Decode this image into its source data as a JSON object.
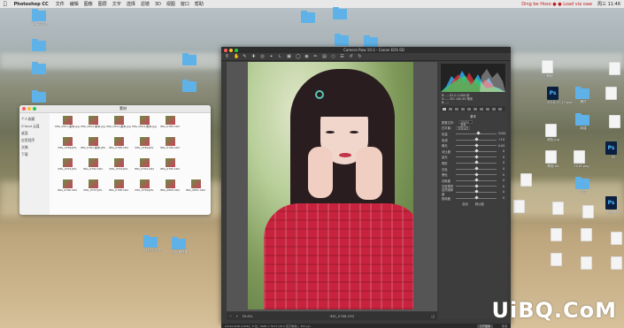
{
  "menubar": {
    "app_name": "Photoshop CC",
    "items": [
      "文件",
      "编辑",
      "图像",
      "图层",
      "文字",
      "选择",
      "滤镜",
      "3D",
      "视图",
      "窗口",
      "帮助"
    ],
    "alert_text": "Ding be Hoso ● ● Load via oaw",
    "clock": "周三 11:46"
  },
  "finder": {
    "title": "素材",
    "sidebar": [
      "个人收藏",
      "iCloud 云盘",
      "桌面",
      "应用程序",
      "文稿",
      "下载"
    ],
    "files": [
      "IMG_0501-副本.jpg",
      "IMG_0502-副本.jpg",
      "IMG_0503-副本.jpg",
      "IMG_0504-副本.jpg",
      "IMG_0785.CR2",
      "",
      "IMG_0786.JPG",
      "IMG_0787-副本.JPG",
      "IMG_0788.CR2",
      "IMG_0789.JPG",
      "IMG_0790.CR2",
      "",
      "IMG_0791.JPG",
      "IMG_0792.CR2",
      "IMG_0793.JPG",
      "IMG_0794.CR2",
      "IMG_0795.CR2",
      "",
      "IMG_0796.CR2",
      "IMG_0797.JPG",
      "IMG_0798.CR2",
      "IMG_0799.JPG",
      "IMG_0800.CR2",
      "IMG_0801.CR2"
    ]
  },
  "desktop": {
    "left_folders": [
      "新建文件夹",
      "",
      "",
      "",
      ""
    ],
    "mid_folders": [
      "新建文件夹",
      "新建文件夹"
    ],
    "top_folders": [
      "",
      "",
      "",
      ""
    ],
    "bottom_labels": [
      "0413文件夹",
      "调色素材集"
    ],
    "right_files": [
      {
        "type": "doc",
        "label": "教程"
      },
      {
        "type": "folder",
        "label": "素材"
      },
      {
        "type": "ps",
        "label": "2018-07-17.psd"
      },
      {
        "type": "doc",
        "label": "调色.jpg"
      },
      {
        "type": "folder",
        "label": "新建"
      },
      {
        "type": "ps",
        "label": "PS"
      },
      {
        "type": "doc",
        "label": "2018.png"
      },
      {
        "type": "doc",
        "label": "教程.txt"
      },
      {
        "type": "ps",
        "label": "封面.psd"
      },
      {
        "type": "folder",
        "label": "文件"
      }
    ]
  },
  "camera_raw": {
    "title": "Camera Raw 10.3  -  Canon EOS 6D",
    "zoom": "39.6%",
    "filename": "IMG_0788.CR2",
    "histogram_info": [
      "R: --- f/2.0 1/400 秒",
      "G: --- ISO 100 85 毫米",
      "B: ---"
    ],
    "panel_sections": {
      "basic": "基本",
      "profile_label": "配置文件：",
      "profile_value": "Adobe 颜色",
      "wb_label": "白平衡：",
      "wb_value": "原照设置",
      "auto": "自动",
      "default": "默认值"
    },
    "sliders": [
      {
        "label": "色温",
        "value": "5200",
        "pos": 0.55
      },
      {
        "label": "色调",
        "value": "+10",
        "pos": 0.52
      },
      {
        "label": "曝光",
        "value": "0.00",
        "pos": 0.5
      },
      {
        "label": "对比度",
        "value": "0",
        "pos": 0.5
      },
      {
        "label": "高光",
        "value": "0",
        "pos": 0.5
      },
      {
        "label": "阴影",
        "value": "0",
        "pos": 0.5
      },
      {
        "label": "白色",
        "value": "0",
        "pos": 0.5
      },
      {
        "label": "黑色",
        "value": "0",
        "pos": 0.5
      },
      {
        "label": "清晰度",
        "value": "0",
        "pos": 0.5
      },
      {
        "label": "去除薄雾",
        "value": "0",
        "pos": 0.5
      },
      {
        "label": "自然饱和度",
        "value": "0",
        "pos": 0.5
      },
      {
        "label": "饱和度",
        "value": "0",
        "pos": 0.5
      }
    ],
    "status_text": "Adobe RGB (1998)；8 位；3648 × 5472 (20.0 百万像素)；300 ppi",
    "open_button": "打开图像",
    "cancel_button": "取消",
    "done_button": "完成"
  },
  "watermark": "UiBQ.CoM",
  "colors": {
    "folder": "#5fb2e8",
    "ps_blue": "#4fb7ff",
    "shirt_red": "#c8233e"
  }
}
